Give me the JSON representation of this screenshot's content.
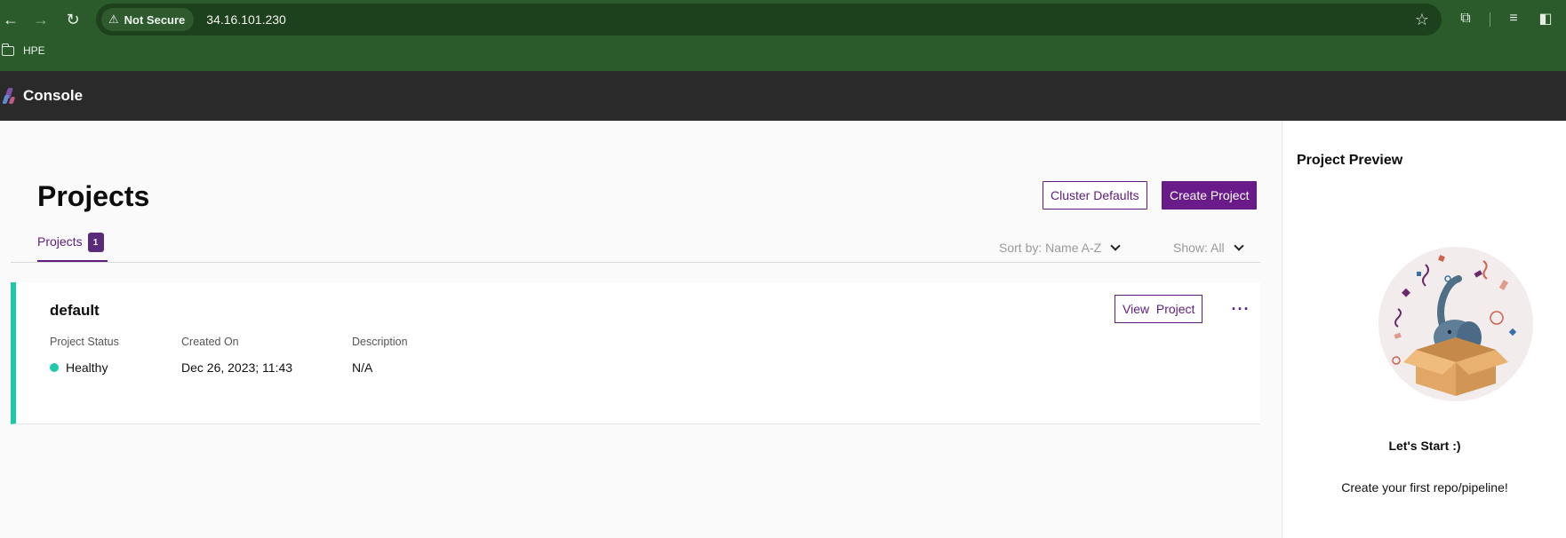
{
  "browser": {
    "security_label": "Not Secure",
    "url": "34.16.101.230",
    "bookmark_folder": "HPE"
  },
  "app": {
    "title": "Console"
  },
  "page": {
    "title": "Projects",
    "cluster_defaults_label": "Cluster Defaults",
    "create_project_label": "Create Project",
    "tab_label": "Projects",
    "tab_count": "1",
    "sort_label": "Sort by: Name A-Z",
    "show_label": "Show: All"
  },
  "project": {
    "name": "default",
    "view_label": "View  Project",
    "more_label": "···",
    "status_header": "Project Status",
    "status_value": "Healthy",
    "created_header": "Created On",
    "created_value": "Dec 26, 2023; 11:43",
    "description_header": "Description",
    "description_value": "N/A",
    "status_color": "#1fc9a8"
  },
  "preview": {
    "title": "Project Preview",
    "heading": "Let's Start :)",
    "text": "Create your first repo/pipeline!"
  },
  "colors": {
    "browser_bg": "#2b5a2b",
    "app_header_bg": "#2a2a2a",
    "accent": "#6a1b8a"
  }
}
